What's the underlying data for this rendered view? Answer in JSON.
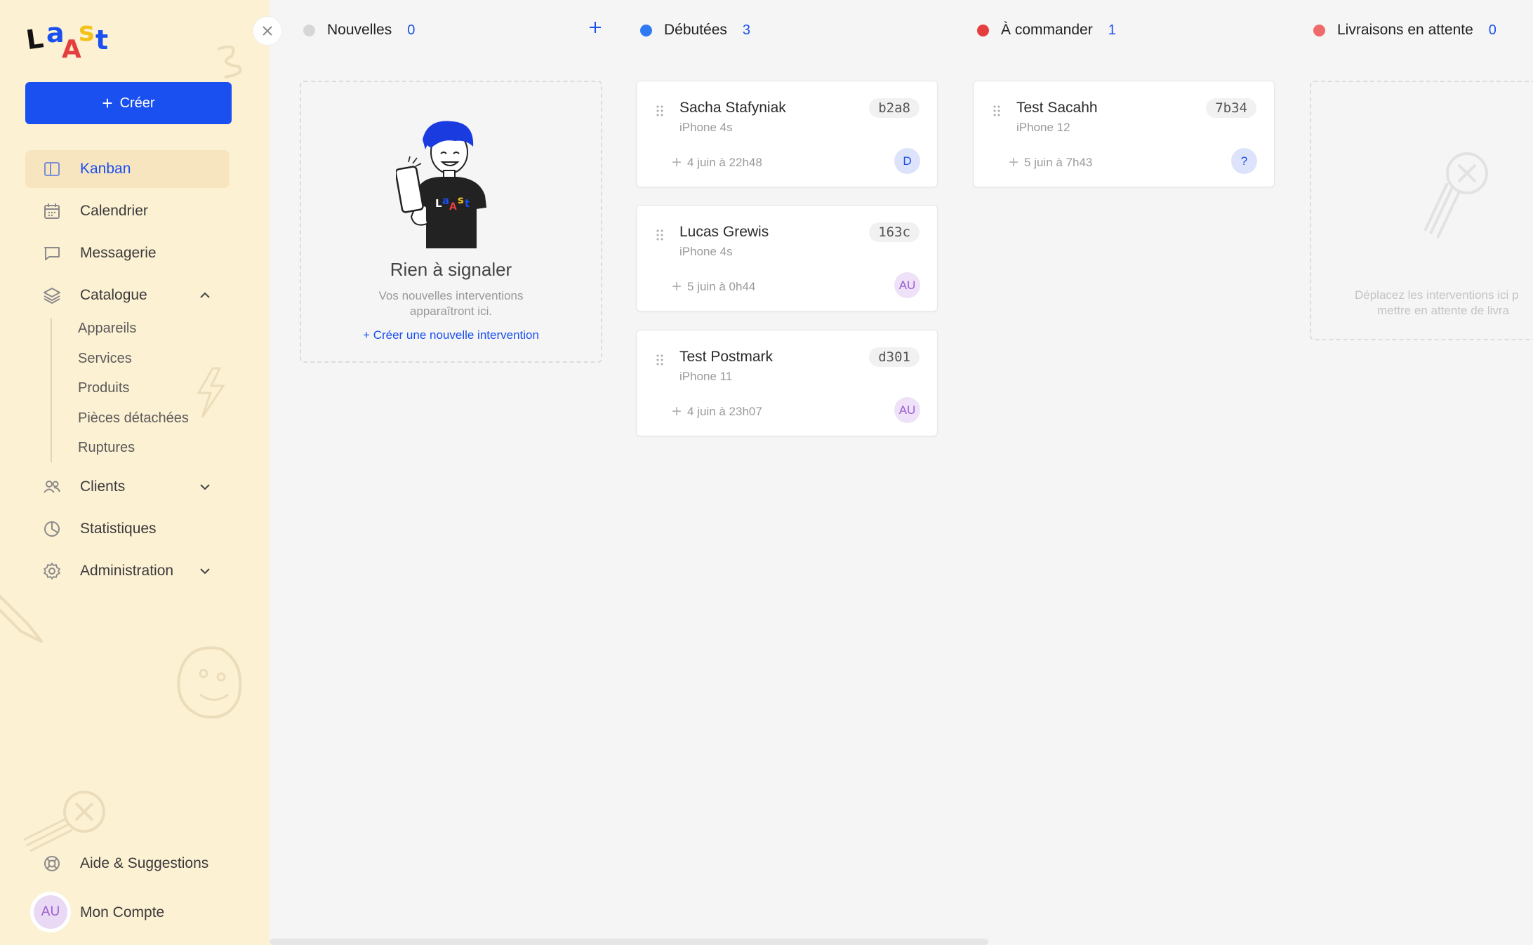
{
  "sidebar": {
    "logo_text": "LAASt",
    "create_label": "Créer",
    "nav": {
      "kanban": "Kanban",
      "calendrier": "Calendrier",
      "messagerie": "Messagerie",
      "catalogue": "Catalogue",
      "clients": "Clients",
      "statistiques": "Statistiques",
      "administration": "Administration",
      "aide": "Aide & Suggestions",
      "compte": "Mon Compte"
    },
    "catalogue_items": [
      "Appareils",
      "Services",
      "Produits",
      "Pièces détachées",
      "Ruptures"
    ],
    "avatar_initials": "AU"
  },
  "columns": [
    {
      "title": "Nouvelles",
      "count": "0",
      "color": "#d6d6d6"
    },
    {
      "title": "Débutées",
      "count": "3",
      "color": "#2f7af2"
    },
    {
      "title": "À commander",
      "count": "1",
      "color": "#e53e3e"
    },
    {
      "title": "Livraisons en attente",
      "count": "0",
      "color": "#f06a6a"
    }
  ],
  "empty_new": {
    "title": "Rien à signaler",
    "line1": "Vos nouvelles interventions",
    "line2": "apparaîtront ici.",
    "link": "Créer une nouvelle intervention"
  },
  "empty_delivery": {
    "line1": "Déplacez les interventions ici p",
    "line2": "mettre en attente de livra"
  },
  "cards": {
    "debutees": [
      {
        "name": "Sacha Stafyniak",
        "device": "iPhone 4s",
        "id": "b2a8",
        "date": "4 juin à 22h48",
        "avatar": "D"
      },
      {
        "name": "Lucas Grewis",
        "device": "iPhone 4s",
        "id": "163c",
        "date": "5 juin à 0h44",
        "avatar": "AU"
      },
      {
        "name": "Test Postmark",
        "device": "iPhone 11",
        "id": "d301",
        "date": "4 juin à 23h07",
        "avatar": "AU"
      }
    ],
    "commander": [
      {
        "name": "Test Sacahh",
        "device": "iPhone 12",
        "id": "7b34",
        "date": "5 juin à 7h43",
        "avatar": "?"
      }
    ]
  },
  "colors": {
    "accent": "#1a4ff0",
    "sidebar_bg": "#fdf1d4",
    "main_bg": "#f5f5f5"
  }
}
